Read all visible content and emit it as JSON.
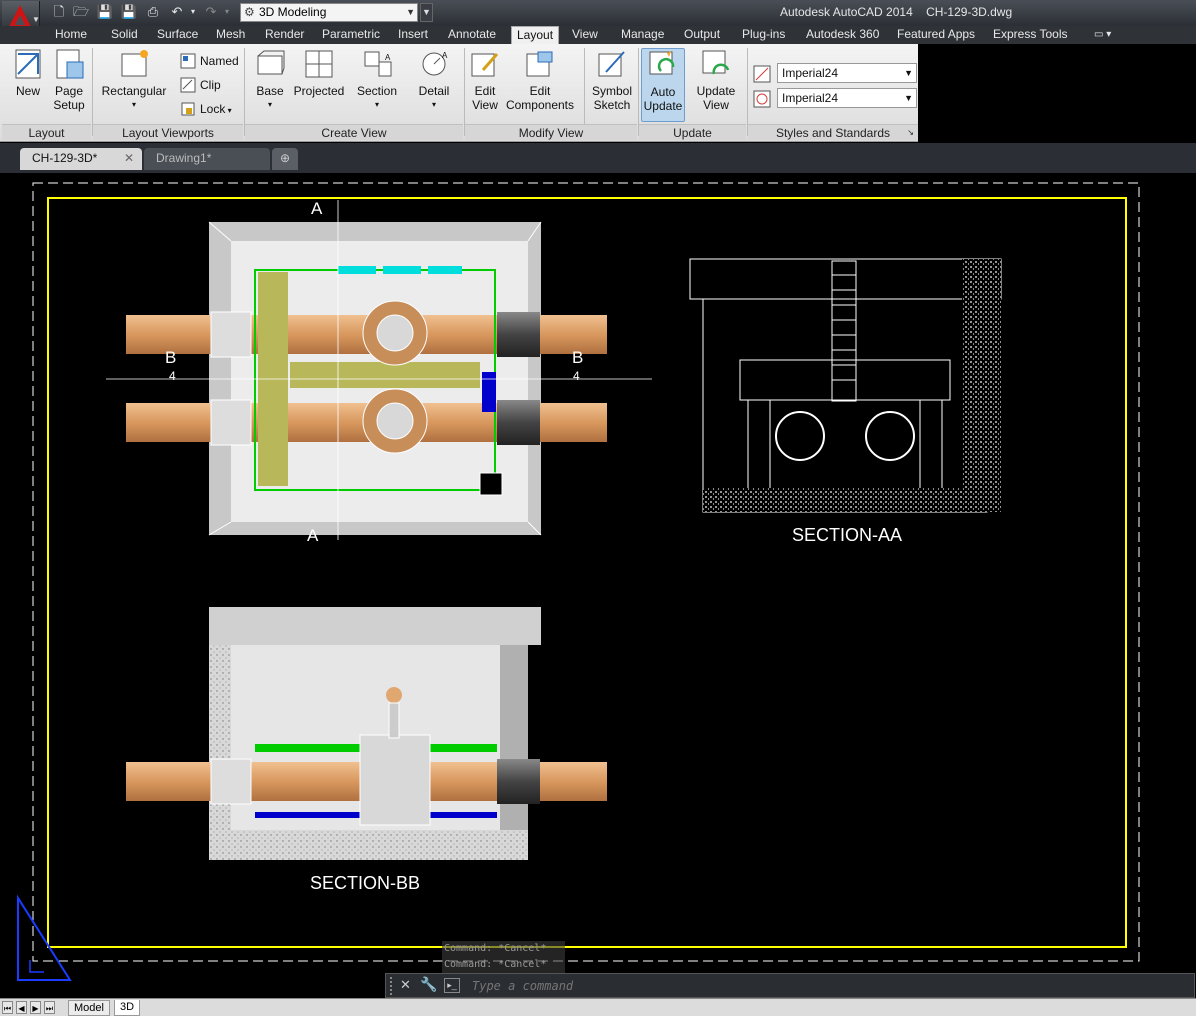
{
  "app": {
    "workspace": "3D Modeling",
    "window_title": "Autodesk AutoCAD 2014    CH-129-3D.dwg"
  },
  "ribbon_tabs": [
    "Home",
    "Solid",
    "Surface",
    "Mesh",
    "Render",
    "Parametric",
    "Insert",
    "Annotate",
    "Layout",
    "View",
    "Manage",
    "Output",
    "Plug-ins",
    "Autodesk 360",
    "Featured Apps",
    "Express Tools"
  ],
  "active_tab": "Layout",
  "panels": {
    "layout": {
      "title": "Layout",
      "new": "New",
      "page_setup_1": "Page",
      "page_setup_2": "Setup"
    },
    "layout_viewports": {
      "title": "Layout Viewports",
      "rectangular": "Rectangular",
      "named": "Named",
      "clip": "Clip",
      "lock": "Lock"
    },
    "create_view": {
      "title": "Create View",
      "base": "Base",
      "projected": "Projected",
      "section": "Section",
      "detail": "Detail"
    },
    "modify_view": {
      "title": "Modify View",
      "edit_view_1": "Edit",
      "edit_view_2": "View",
      "edit_comp_1": "Edit",
      "edit_comp_2": "Components",
      "symbol_1": "Symbol",
      "symbol_2": "Sketch"
    },
    "update": {
      "title": "Update",
      "auto_1": "Auto",
      "auto_2": "Update",
      "update_1": "Update",
      "update_2": "View"
    },
    "styles": {
      "title": "Styles and Standards",
      "style1": "Imperial24",
      "style2": "Imperial24"
    }
  },
  "doc_tabs": [
    {
      "label": "CH-129-3D*",
      "active": true
    },
    {
      "label": "Drawing1*",
      "active": false
    }
  ],
  "drawing": {
    "section_aa_title": "SECTION-AA",
    "section_bb_title": "SECTION-BB",
    "marker_a": "A",
    "marker_b": "B",
    "marker_num": "4"
  },
  "command": {
    "history_1": "Command: *Cancel*",
    "history_2": "Command: *Cancel*",
    "placeholder": "Type a command"
  },
  "status_tabs": [
    "Model",
    "3D"
  ],
  "colors": {
    "viewport_border": "#ffff00",
    "background": "#000000",
    "pipe": "#e0a870"
  }
}
